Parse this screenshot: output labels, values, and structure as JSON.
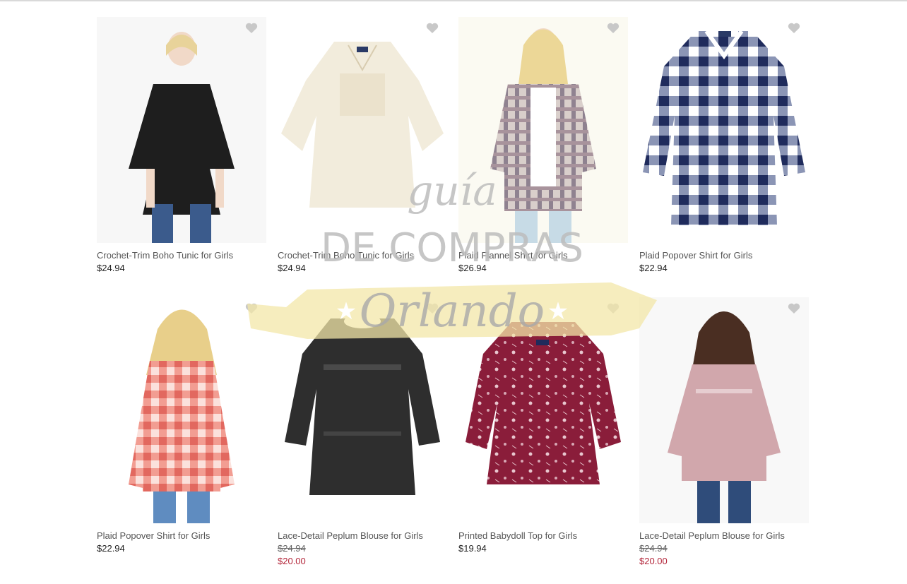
{
  "products": [
    {
      "title": "Crochet-Trim Boho Tunic for Girls",
      "price": "$24.94",
      "icon": "heart-icon"
    },
    {
      "title": "Crochet-Trim Boho Tunic for Girls",
      "price": "$24.94",
      "icon": "heart-icon"
    },
    {
      "title": "Plaid Flannel Shirt for Girls",
      "price": "$26.94",
      "icon": "heart-icon"
    },
    {
      "title": "Plaid Popover Shirt for Girls",
      "price": "$22.94",
      "icon": "heart-icon"
    },
    {
      "title": "Plaid Popover Shirt for Girls",
      "price": "$22.94",
      "icon": "heart-icon"
    },
    {
      "title": "Lace-Detail Peplum Blouse for Girls",
      "was_price": "$24.94",
      "sale_price": "$20.00",
      "icon": "heart-icon"
    },
    {
      "title": "Printed Babydoll Top for Girls",
      "price": "$19.94",
      "icon": "heart-icon"
    },
    {
      "title": "Lace-Detail Peplum Blouse for Girls",
      "was_price": "$24.94",
      "sale_price": "$20.00",
      "icon": "heart-icon"
    }
  ],
  "watermark": {
    "line1": "guía",
    "line2": "DE COMPRAS",
    "line3": "Orlando"
  },
  "colors": {
    "sale": "#b3263a",
    "heart": "#c8c8c8",
    "title": "#555555",
    "banner": "#f3e7a8"
  }
}
